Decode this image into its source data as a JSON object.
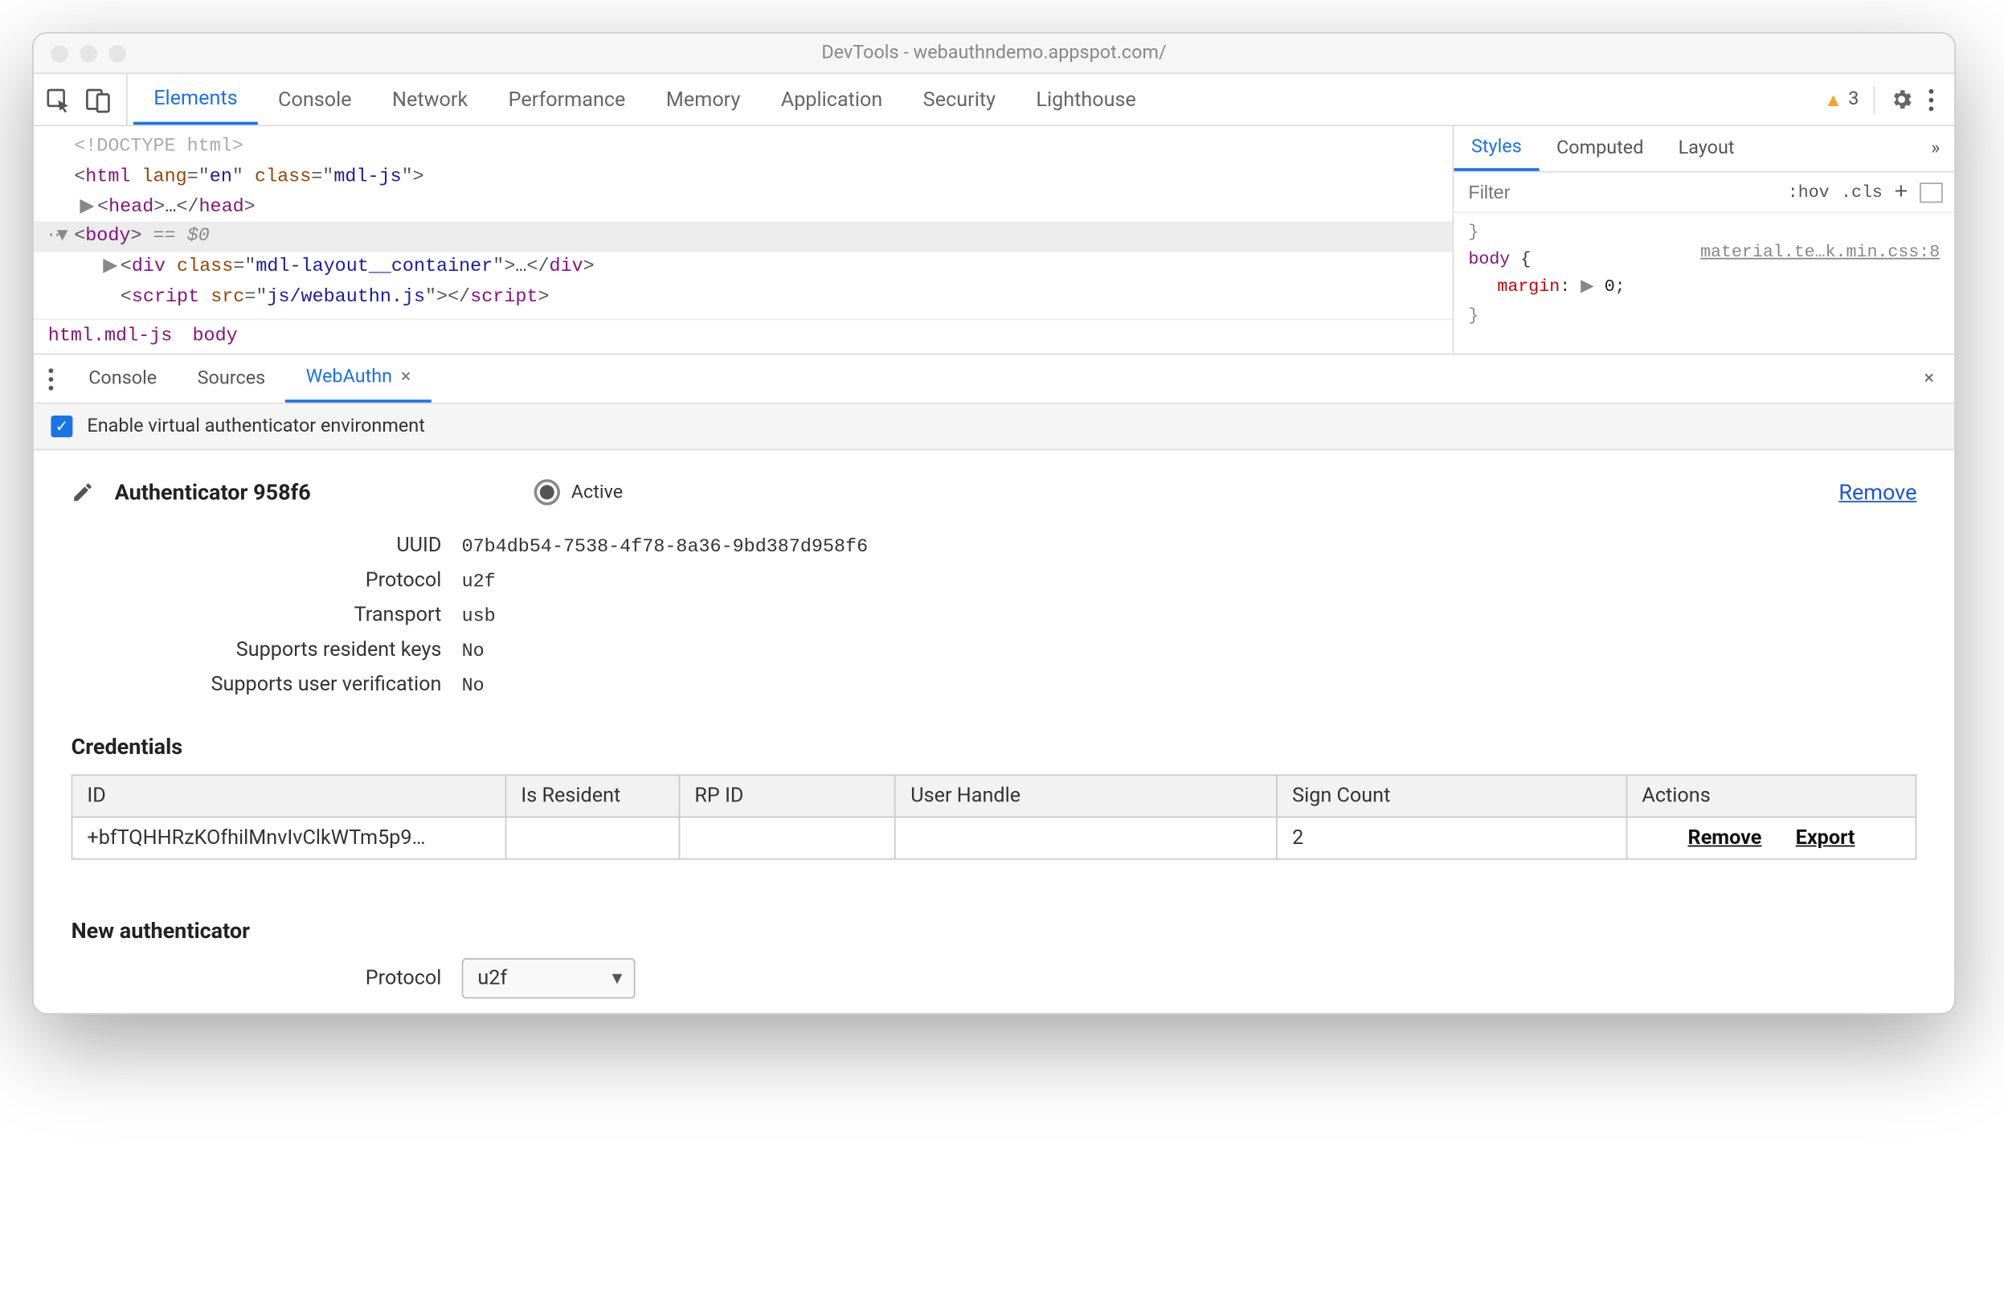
{
  "window": {
    "title": "DevTools - webauthndemo.appspot.com/"
  },
  "toolbar": {
    "tabs": [
      "Elements",
      "Console",
      "Network",
      "Performance",
      "Memory",
      "Application",
      "Security",
      "Lighthouse"
    ],
    "active_tab": "Elements",
    "warning_count": "3"
  },
  "dom": {
    "lines": {
      "doctype": "<!DOCTYPE html>",
      "html_open": {
        "tag": "html",
        "attrs": [
          {
            "n": "lang",
            "v": "en"
          },
          {
            "n": "class",
            "v": "mdl-js"
          }
        ]
      },
      "head": "<head>…</head>",
      "body_sel": "== $0",
      "div": {
        "tag": "div",
        "attrs": [
          {
            "n": "class",
            "v": "mdl-layout__container"
          }
        ]
      },
      "script": {
        "tag": "script",
        "attrs": [
          {
            "n": "src",
            "v": "js/webauthn.js"
          }
        ]
      }
    },
    "breadcrumb": [
      "html.mdl-js",
      "body"
    ]
  },
  "styles": {
    "tabs": [
      "Styles",
      "Computed",
      "Layout"
    ],
    "active_tab": "Styles",
    "filter_placeholder": "Filter",
    "hov": ":hov",
    "cls": ".cls",
    "source": "material.te…k.min.css:8",
    "rule": {
      "selector": "body",
      "prop": "margin",
      "val": "0"
    }
  },
  "drawer": {
    "tabs": [
      "Console",
      "Sources",
      "WebAuthn"
    ],
    "active_tab": "WebAuthn",
    "enable_label": "Enable virtual authenticator environment"
  },
  "authenticator": {
    "title": "Authenticator 958f6",
    "active_label": "Active",
    "remove_label": "Remove",
    "props": [
      {
        "label": "UUID",
        "value": "07b4db54-7538-4f78-8a36-9bd387d958f6"
      },
      {
        "label": "Protocol",
        "value": "u2f"
      },
      {
        "label": "Transport",
        "value": "usb"
      },
      {
        "label": "Supports resident keys",
        "value": "No"
      },
      {
        "label": "Supports user verification",
        "value": "No"
      }
    ]
  },
  "credentials": {
    "title": "Credentials",
    "headers": [
      "ID",
      "Is Resident",
      "RP ID",
      "User Handle",
      "Sign Count",
      "Actions"
    ],
    "rows": [
      {
        "id": "+bfTQHHRzKOfhilMnvIvClkWTm5p9…",
        "is_resident": "",
        "rp_id": "",
        "user_handle": "",
        "sign_count": "2"
      }
    ],
    "action_remove": "Remove",
    "action_export": "Export"
  },
  "new_auth": {
    "title": "New authenticator",
    "protocol_label": "Protocol",
    "protocol_value": "u2f"
  }
}
